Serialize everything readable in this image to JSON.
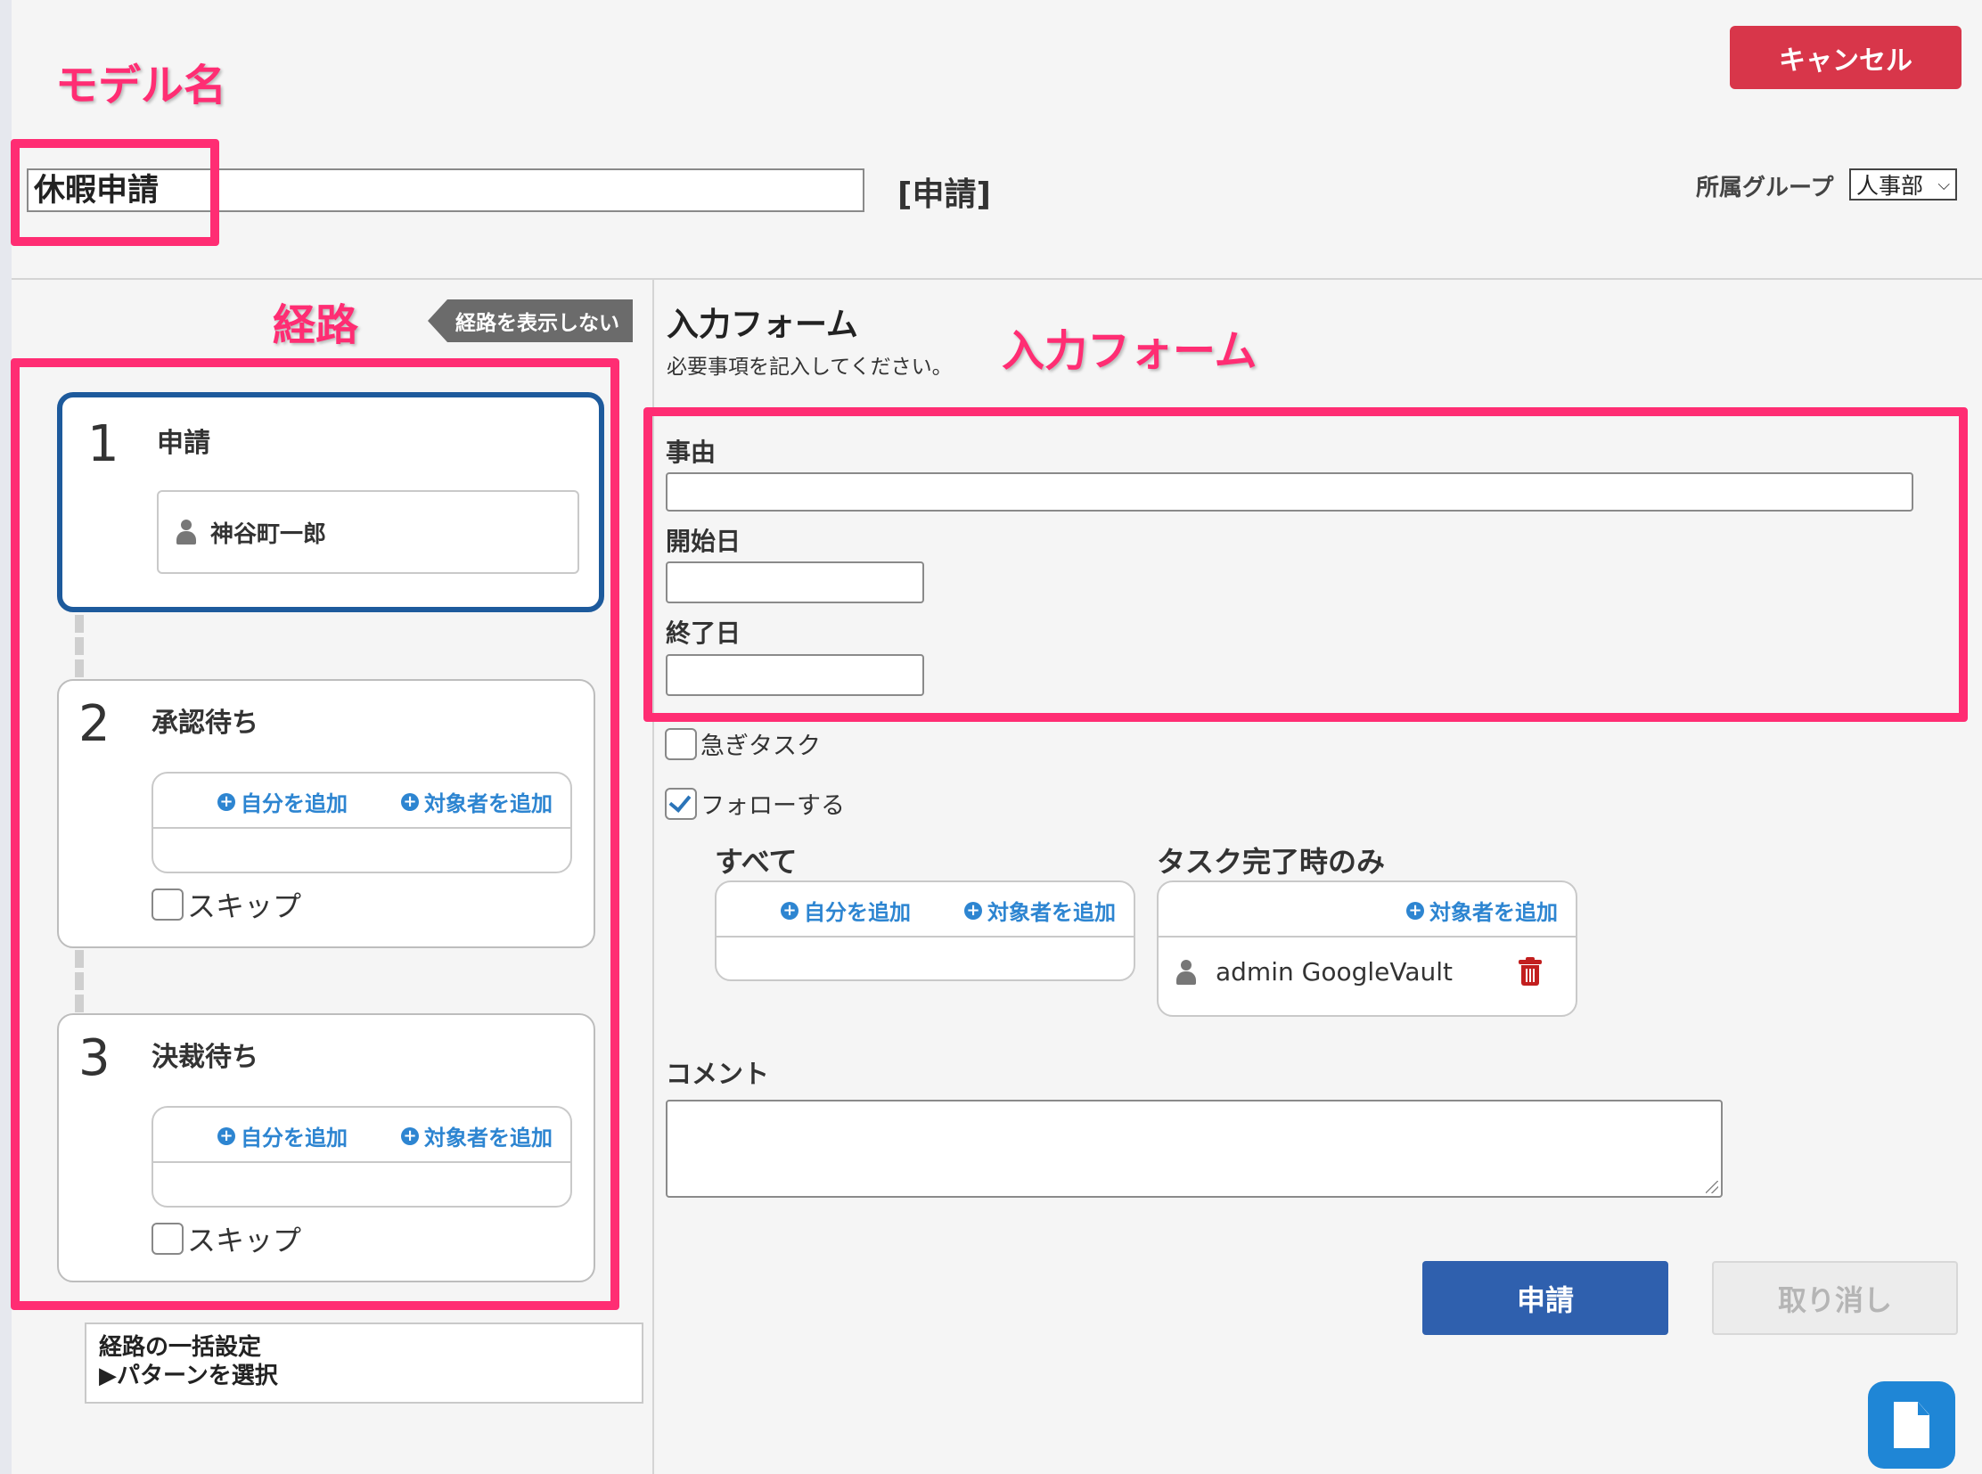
{
  "header": {
    "cancel_label": "キャンセル",
    "model_name_value": "休暇申請",
    "status_tag": "[申請]",
    "group_label": "所属グループ",
    "group_value": "人事部",
    "group_chevron": "⌵"
  },
  "annotations": {
    "model_name": "モデル名",
    "route": "経路",
    "input_form": "入力フォーム"
  },
  "route": {
    "hide_label": "経路を表示しない",
    "steps": [
      {
        "number": "1",
        "title": "申請",
        "assignee": "神谷町一郎"
      },
      {
        "number": "2",
        "title": "承認待ち",
        "add_self": "自分を追加",
        "add_target": "対象者を追加",
        "skip_label": "スキップ"
      },
      {
        "number": "3",
        "title": "決裁待ち",
        "add_self": "自分を追加",
        "add_target": "対象者を追加",
        "skip_label": "スキップ"
      }
    ],
    "bulk_title": "経路の一括設定",
    "bulk_link": "▶パターンを選択"
  },
  "form": {
    "title": "入力フォーム",
    "description": "必要事項を記入してください。",
    "fields": [
      {
        "label": "事由",
        "value": ""
      },
      {
        "label": "開始日",
        "value": ""
      },
      {
        "label": "終了日",
        "value": ""
      }
    ],
    "urgent_label": "急ぎタスク",
    "urgent_checked": false,
    "follow_label": "フォローする",
    "follow_checked": true,
    "follow_all": {
      "title": "すべて",
      "add_self": "自分を追加",
      "add_target": "対象者を追加"
    },
    "follow_done": {
      "title": "タスク完了時のみ",
      "add_target": "対象者を追加",
      "members": [
        "admin GoogleVault"
      ]
    },
    "comment_label": "コメント",
    "comment_value": ""
  },
  "actions": {
    "submit_label": "申請",
    "undo_label": "取り消し"
  },
  "colors": {
    "cancel": "#d8364a",
    "submit": "#2f60ae",
    "annotation": "#ff2d73",
    "link": "#2d85d1",
    "active_step_border": "#1d5a9c"
  }
}
